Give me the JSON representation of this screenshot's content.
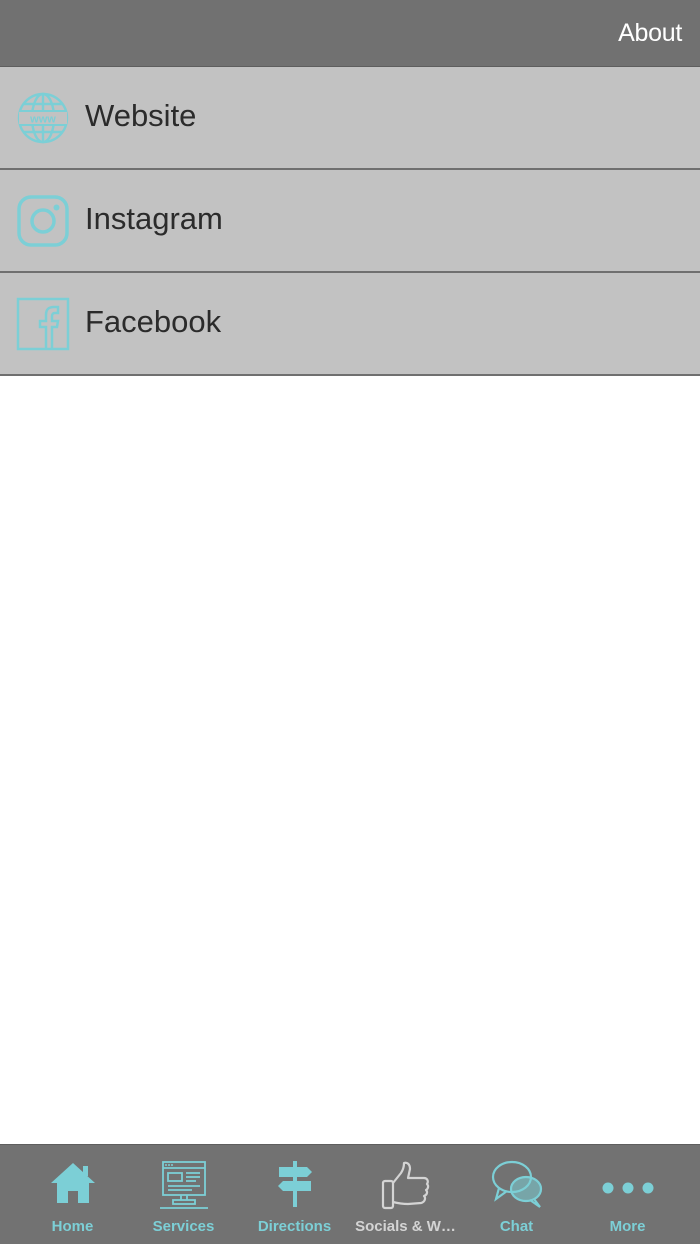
{
  "header": {
    "title": "About"
  },
  "links": [
    {
      "label": "Website",
      "icon": "globe-www-icon"
    },
    {
      "label": "Instagram",
      "icon": "instagram-icon"
    },
    {
      "label": "Facebook",
      "icon": "facebook-icon"
    }
  ],
  "tabbar": {
    "items": [
      {
        "label": "Home",
        "icon": "home-icon"
      },
      {
        "label": "Services",
        "icon": "computer-icon"
      },
      {
        "label": "Directions",
        "icon": "signpost-icon"
      },
      {
        "label": "Socials & W…",
        "icon": "thumbs-up-icon"
      },
      {
        "label": "Chat",
        "icon": "chat-bubbles-icon"
      },
      {
        "label": "More",
        "icon": "more-dots-icon"
      }
    ]
  },
  "colors": {
    "accent": "#7ccfd6",
    "header_bg": "#717171",
    "row_bg": "#c2c2c2",
    "tabbar_bg": "#727272"
  }
}
